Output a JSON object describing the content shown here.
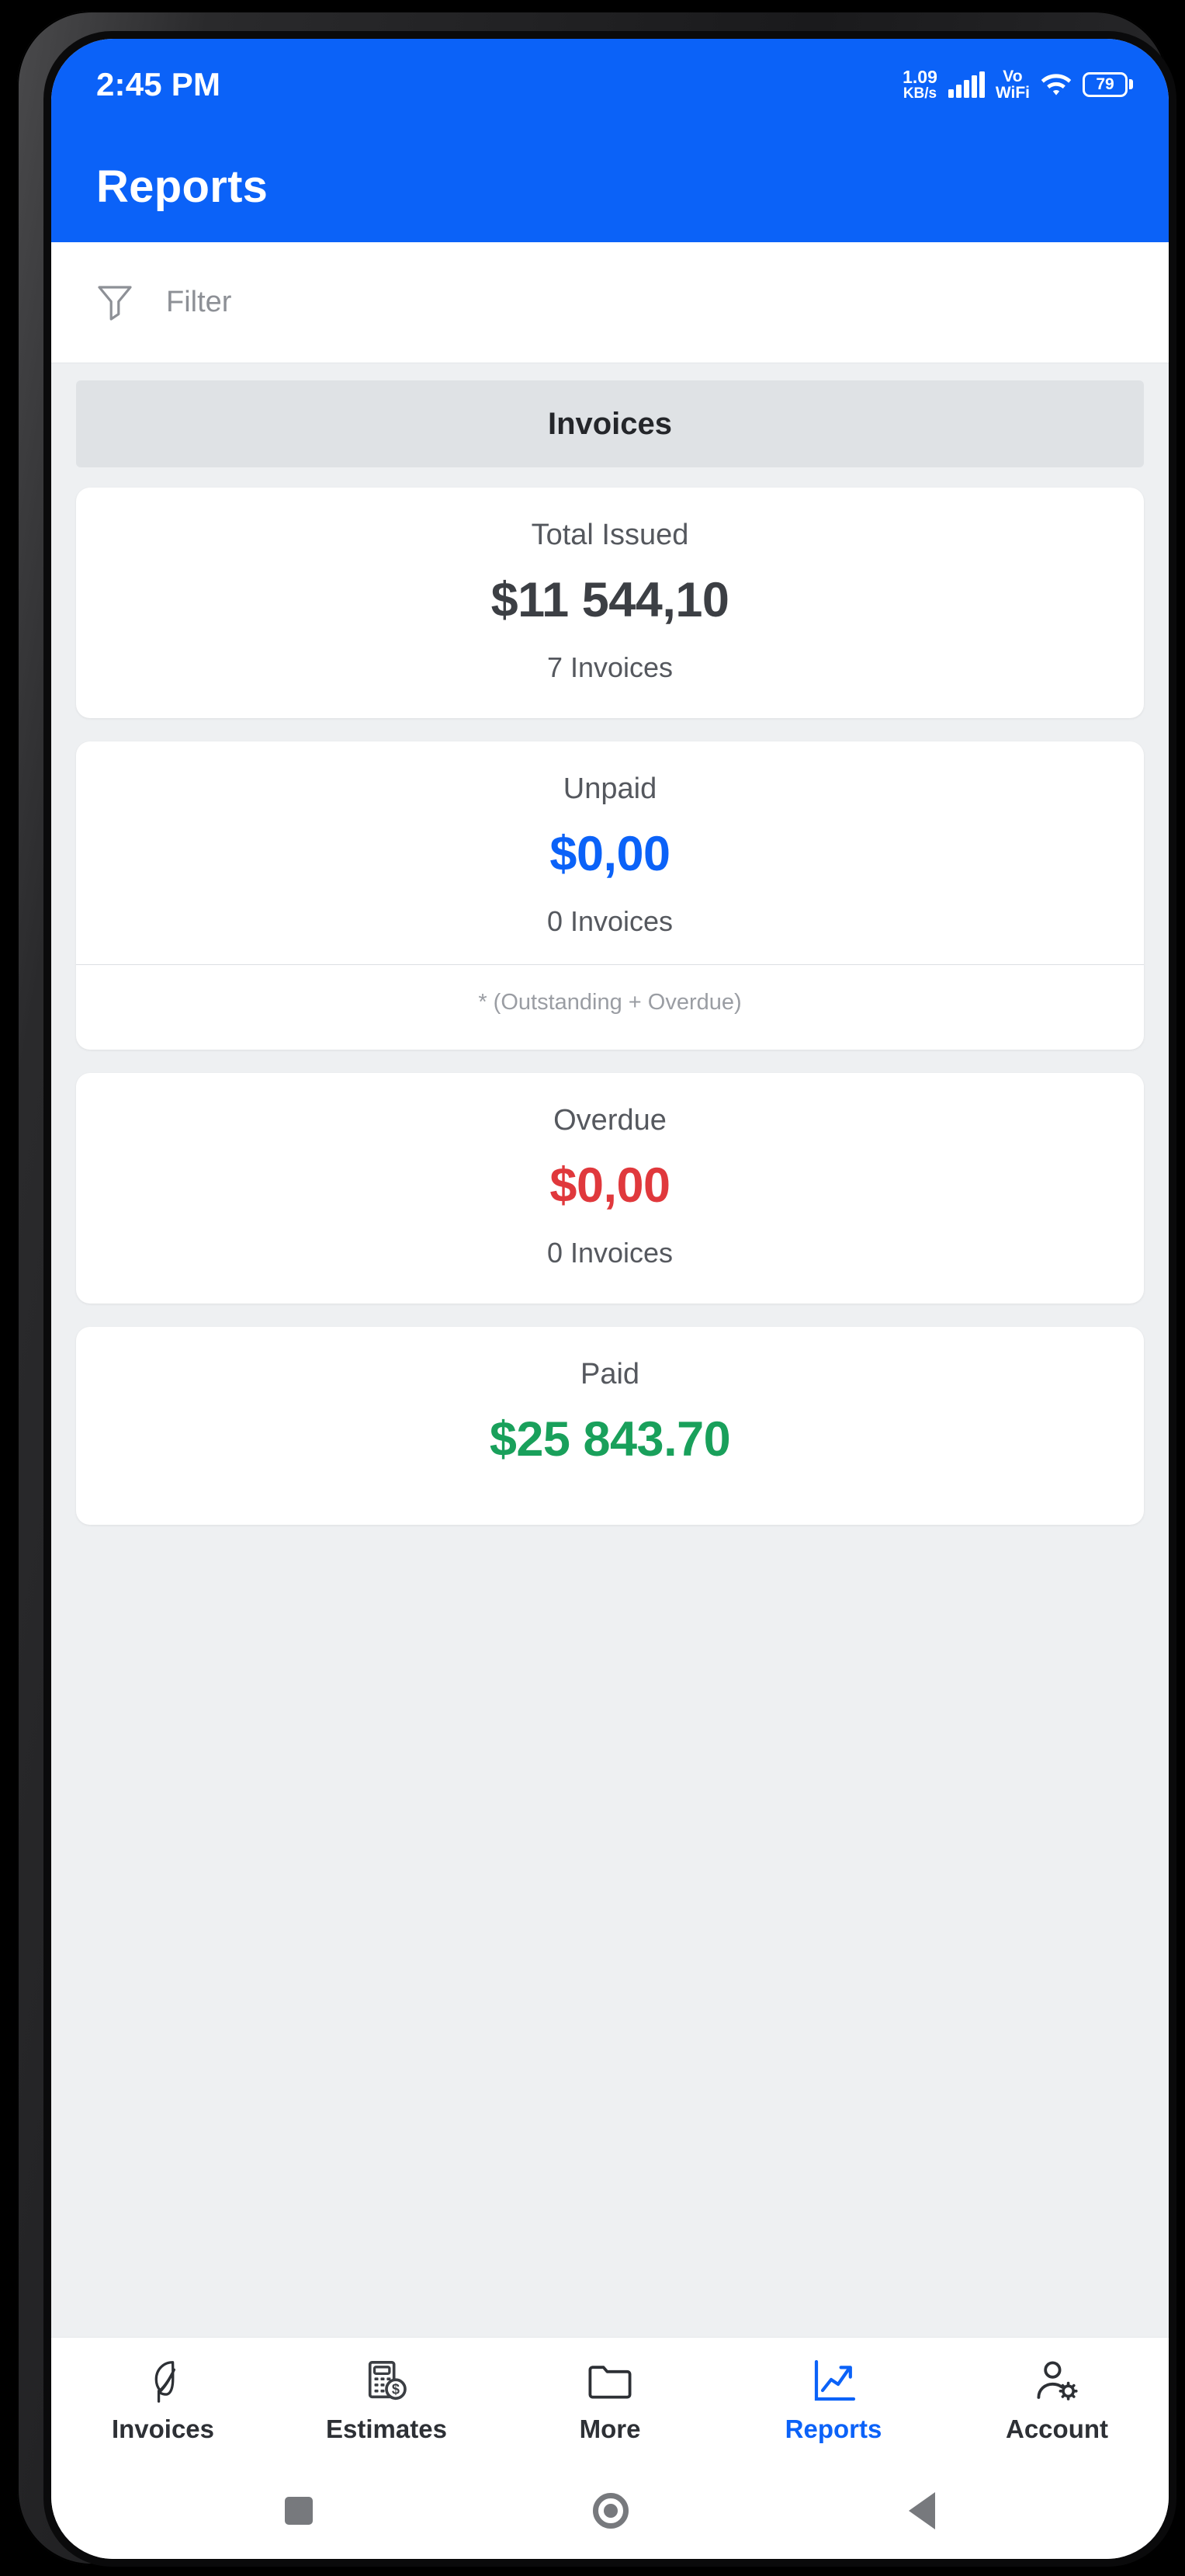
{
  "status_bar": {
    "time": "2:45 PM",
    "net_speed_value": "1.09",
    "net_speed_unit": "KB/s",
    "volte_line1": "Vo",
    "volte_line2": "WiFi",
    "battery_level": "79",
    "signal_icon": "signal-bars-icon",
    "wifi_icon": "wifi-icon",
    "battery_icon": "battery-icon"
  },
  "app_bar": {
    "title": "Reports"
  },
  "filter": {
    "label": "Filter",
    "icon": "funnel-icon"
  },
  "section": {
    "title": "Invoices"
  },
  "cards": [
    {
      "label": "Total Issued",
      "amount": "$11 544,10",
      "count": "7 Invoices",
      "color": "#3c3f44",
      "note": null
    },
    {
      "label": "Unpaid",
      "amount": "$0,00",
      "count": "0 Invoices",
      "color": "#0b62f8",
      "note": "* (Outstanding + Overdue)"
    },
    {
      "label": "Overdue",
      "amount": "$0,00",
      "count": "0 Invoices",
      "color": "#e0383c",
      "note": null
    },
    {
      "label": "Paid",
      "amount": "$25 843.70",
      "count": "",
      "color": "#19a05b",
      "note": null
    }
  ],
  "bottom_nav": {
    "items": [
      {
        "label": "Invoices",
        "icon": "feather-icon",
        "active": false
      },
      {
        "label": "Estimates",
        "icon": "calculator-dollar-icon",
        "active": false
      },
      {
        "label": "More",
        "icon": "folder-icon",
        "active": false
      },
      {
        "label": "Reports",
        "icon": "trending-up-icon",
        "active": true
      },
      {
        "label": "Account",
        "icon": "user-gear-icon",
        "active": false
      }
    ],
    "active_color": "#0b62f8"
  },
  "system_nav": {
    "recents": "square-icon",
    "home": "circle-icon",
    "back": "triangle-back-icon"
  },
  "theme": {
    "accent": "#0b62f8",
    "page_bg": "#eef0f2",
    "card_bg": "#ffffff",
    "header_bg": "#dfe2e5"
  }
}
